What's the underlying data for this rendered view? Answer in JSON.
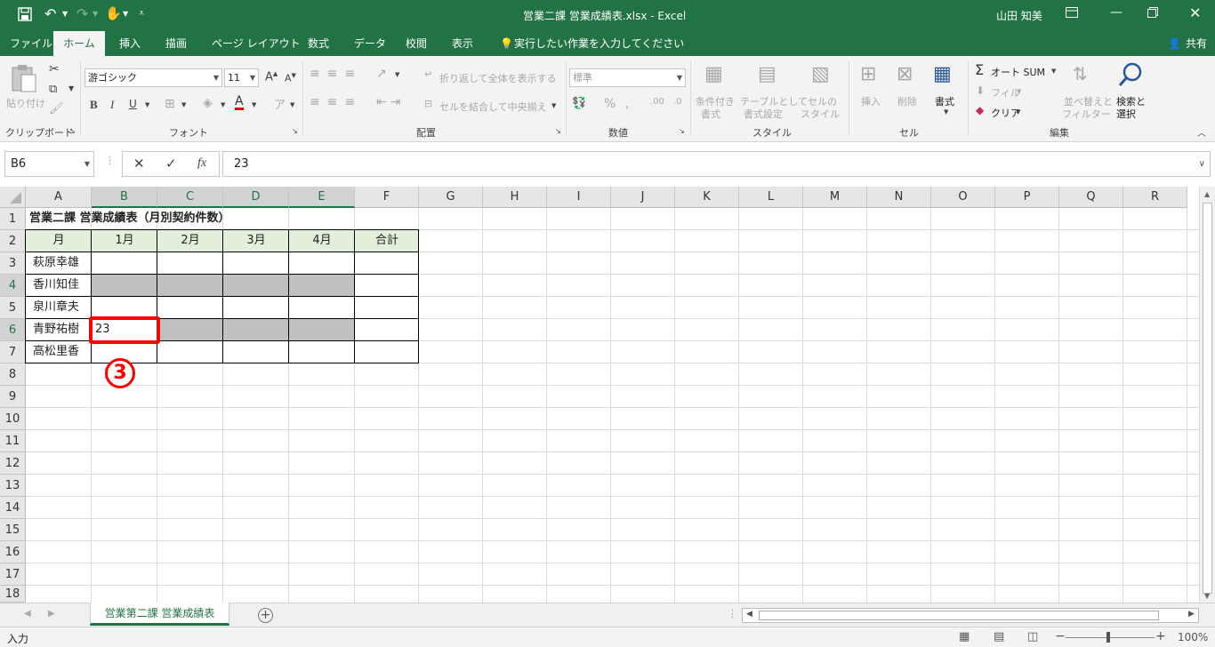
{
  "window": {
    "title": "営業二課 営業成績表.xlsx  -  Excel",
    "user": "山田 知美"
  },
  "tabs": [
    "ファイル",
    "ホーム",
    "挿入",
    "描画",
    "ページ レイアウト",
    "数式",
    "データ",
    "校閲",
    "表示"
  ],
  "tell_me": "実行したい作業を入力してください",
  "share": "共有",
  "ribbon": {
    "paste": "貼り付け",
    "clipboard": "クリップボード",
    "font_name": "游ゴシック",
    "font_size": "11",
    "font_group": "フォント",
    "wrap_text": "折り返して全体を表示する",
    "merge_center": "セルを結合して中央揃え",
    "alignment_group": "配置",
    "number_format": "標準",
    "number_group": "数値",
    "cond_format": [
      "条件付き",
      "書式"
    ],
    "format_table": [
      "テーブルとして",
      "書式設定"
    ],
    "cell_styles": [
      "セルの",
      "スタイル"
    ],
    "styles_group": "スタイル",
    "insert": "挿入",
    "delete": "削除",
    "format": "書式",
    "cells_group": "セル",
    "autosum": "オート SUM",
    "fill": "フィル",
    "clear": "クリア",
    "sort_filter": [
      "並べ替えと",
      "フィルター"
    ],
    "find_select": [
      "検索と",
      "選択"
    ],
    "editing_group": "編集"
  },
  "formula_bar": {
    "name_box": "B6",
    "value": "23",
    "fx": "fx"
  },
  "columns": [
    "A",
    "B",
    "C",
    "D",
    "E",
    "F",
    "G",
    "H",
    "I",
    "J",
    "K",
    "L",
    "M",
    "N",
    "O",
    "P",
    "Q",
    "R"
  ],
  "rows": [
    "1",
    "2",
    "3",
    "4",
    "5",
    "6",
    "7",
    "8",
    "9",
    "10",
    "11",
    "12",
    "13",
    "14",
    "15",
    "16",
    "17",
    "18"
  ],
  "table": {
    "title": "営業二課 営業成績表（月別契約件数）",
    "headers": [
      "月",
      "1月",
      "2月",
      "3月",
      "4月",
      "合計"
    ],
    "names": [
      "萩原幸雄",
      "香川知佳",
      "泉川章夫",
      "青野祐樹",
      "高松里香"
    ],
    "b6_value": "23"
  },
  "annotation": "3",
  "sheet_tab": "営業第二課 営業成績表",
  "status": {
    "mode": "入力",
    "zoom": "100%"
  },
  "colors": {
    "excel_green": "#217346",
    "header_fill": "#e2efda",
    "gray_fill": "#c0c0c0",
    "annotation_red": "#ff0000"
  }
}
